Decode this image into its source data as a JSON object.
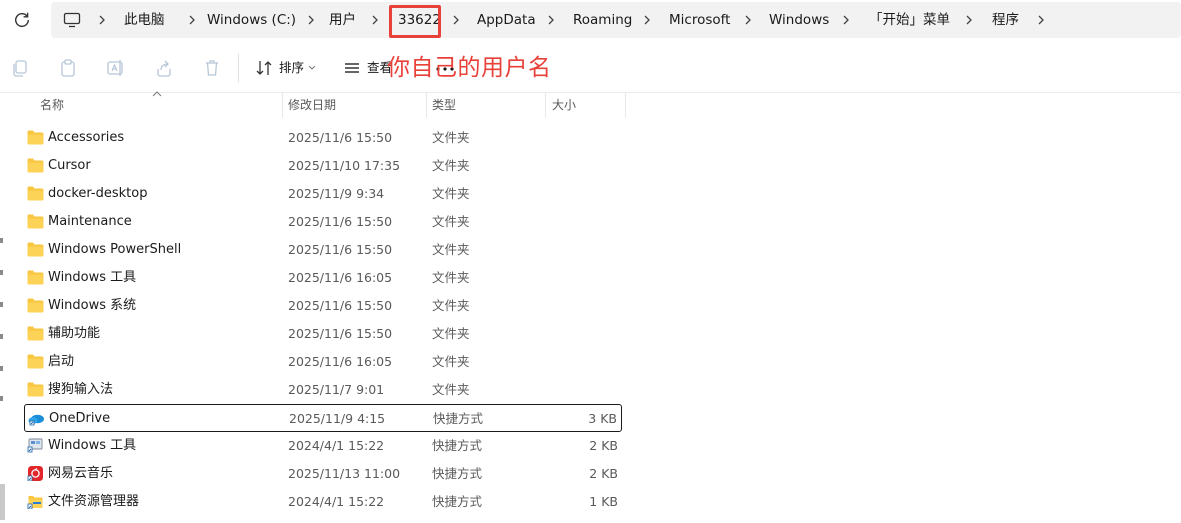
{
  "breadcrumb": {
    "items": [
      "此电脑",
      "Windows (C:)",
      "用户",
      "33622",
      "AppData",
      "Roaming",
      "Microsoft",
      "Windows",
      "「开始」菜单",
      "程序"
    ]
  },
  "toolbar": {
    "sort_label": "排序",
    "view_label": "查看"
  },
  "annotation": "你自己的用户名",
  "columns": {
    "name": "名称",
    "modified": "修改日期",
    "type": "类型",
    "size": "大小"
  },
  "files": [
    {
      "name": "Accessories",
      "modified": "2025/11/6 15:50",
      "type": "文件夹",
      "size": "",
      "icon": "folder-icon"
    },
    {
      "name": "Cursor",
      "modified": "2025/11/10 17:35",
      "type": "文件夹",
      "size": "",
      "icon": "folder-icon"
    },
    {
      "name": "docker-desktop",
      "modified": "2025/11/9 9:34",
      "type": "文件夹",
      "size": "",
      "icon": "folder-icon"
    },
    {
      "name": "Maintenance",
      "modified": "2025/11/6 15:50",
      "type": "文件夹",
      "size": "",
      "icon": "folder-icon"
    },
    {
      "name": "Windows PowerShell",
      "modified": "2025/11/6 15:50",
      "type": "文件夹",
      "size": "",
      "icon": "folder-icon"
    },
    {
      "name": "Windows 工具",
      "modified": "2025/11/6 16:05",
      "type": "文件夹",
      "size": "",
      "icon": "folder-icon"
    },
    {
      "name": "Windows 系统",
      "modified": "2025/11/6 15:50",
      "type": "文件夹",
      "size": "",
      "icon": "folder-icon"
    },
    {
      "name": "辅助功能",
      "modified": "2025/11/6 15:50",
      "type": "文件夹",
      "size": "",
      "icon": "folder-icon"
    },
    {
      "name": "启动",
      "modified": "2025/11/6 16:05",
      "type": "文件夹",
      "size": "",
      "icon": "folder-icon"
    },
    {
      "name": "搜狗输入法",
      "modified": "2025/11/7 9:01",
      "type": "文件夹",
      "size": "",
      "icon": "folder-icon"
    },
    {
      "name": "OneDrive",
      "modified": "2025/11/9 4:15",
      "type": "快捷方式",
      "size": "3 KB",
      "icon": "onedrive-icon"
    },
    {
      "name": "Windows 工具",
      "modified": "2024/4/1 15:22",
      "type": "快捷方式",
      "size": "2 KB",
      "icon": "windows-tools-shortcut-icon"
    },
    {
      "name": "网易云音乐",
      "modified": "2025/11/13 11:00",
      "type": "快捷方式",
      "size": "2 KB",
      "icon": "netease-music-icon"
    },
    {
      "name": "文件资源管理器",
      "modified": "2024/4/1 15:22",
      "type": "快捷方式",
      "size": "1 KB",
      "icon": "file-explorer-icon"
    }
  ],
  "colors": {
    "highlight": "#e8413a",
    "folder": "#f8c641",
    "selected_border": "#1a1a1a"
  }
}
